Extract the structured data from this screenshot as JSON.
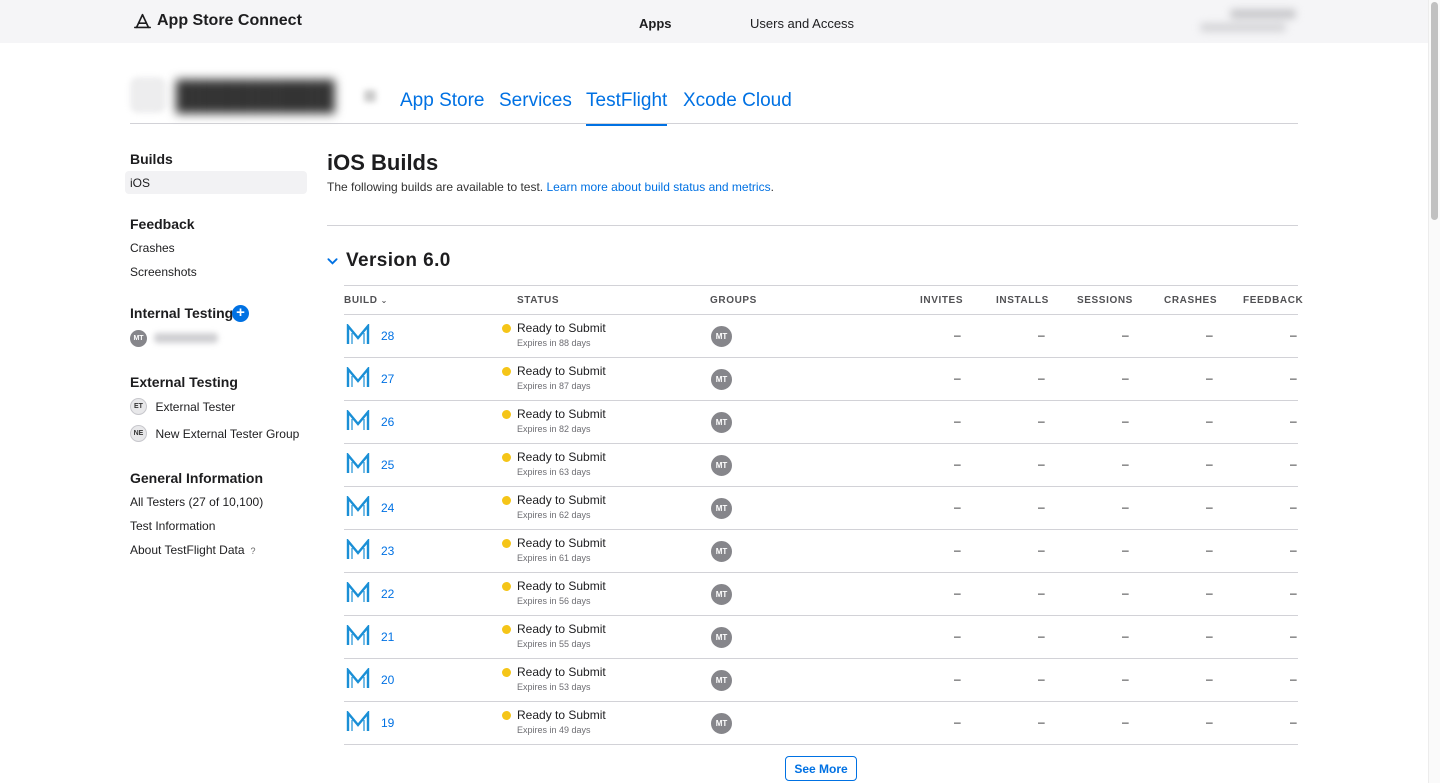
{
  "topbar": {
    "brand": "App Store Connect",
    "nav": [
      {
        "label": "Apps"
      },
      {
        "label": "Users and Access"
      }
    ]
  },
  "app_header": {
    "tabs": [
      {
        "label": "App Store",
        "active": false
      },
      {
        "label": "Services",
        "active": false
      },
      {
        "label": "TestFlight",
        "active": true
      },
      {
        "label": "Xcode Cloud",
        "active": false
      }
    ]
  },
  "sidebar": {
    "builds": {
      "title": "Builds",
      "items": [
        {
          "label": "iOS",
          "selected": true
        }
      ]
    },
    "feedback": {
      "title": "Feedback",
      "items": [
        {
          "label": "Crashes"
        },
        {
          "label": "Screenshots"
        }
      ]
    },
    "internal": {
      "title": "Internal Testing",
      "add": "+",
      "groups": [
        {
          "initials": "MT"
        }
      ]
    },
    "external": {
      "title": "External Testing",
      "groups": [
        {
          "initials": "ET",
          "label": "External Tester"
        },
        {
          "initials": "NE",
          "label": "New External Tester Group"
        }
      ]
    },
    "general": {
      "title": "General Information",
      "items": [
        {
          "label": "All Testers (27 of 10,100)"
        },
        {
          "label": "Test Information"
        },
        {
          "label": "About TestFlight Data",
          "help": "?"
        }
      ]
    }
  },
  "main": {
    "title": "iOS Builds",
    "subtitle_text": "The following builds are available to test.",
    "subtitle_link": "Learn more about build status and metrics",
    "subtitle_end": ".",
    "version": "Version 6.0",
    "columns": [
      "BUILD",
      "STATUS",
      "GROUPS",
      "INVITES",
      "INSTALLS",
      "SESSIONS",
      "CRASHES",
      "FEEDBACK"
    ],
    "status_color": "#f5c518",
    "rows": [
      {
        "build": "28",
        "status": "Ready to Submit",
        "expires": "Expires in 88 days",
        "group": "MT",
        "invites": "–",
        "installs": "–",
        "sessions": "–",
        "crashes": "–",
        "feedback": "–"
      },
      {
        "build": "27",
        "status": "Ready to Submit",
        "expires": "Expires in 87 days",
        "group": "MT",
        "invites": "–",
        "installs": "–",
        "sessions": "–",
        "crashes": "–",
        "feedback": "–"
      },
      {
        "build": "26",
        "status": "Ready to Submit",
        "expires": "Expires in 82 days",
        "group": "MT",
        "invites": "–",
        "installs": "–",
        "sessions": "–",
        "crashes": "–",
        "feedback": "–"
      },
      {
        "build": "25",
        "status": "Ready to Submit",
        "expires": "Expires in 63 days",
        "group": "MT",
        "invites": "–",
        "installs": "–",
        "sessions": "–",
        "crashes": "–",
        "feedback": "–"
      },
      {
        "build": "24",
        "status": "Ready to Submit",
        "expires": "Expires in 62 days",
        "group": "MT",
        "invites": "–",
        "installs": "–",
        "sessions": "–",
        "crashes": "–",
        "feedback": "–"
      },
      {
        "build": "23",
        "status": "Ready to Submit",
        "expires": "Expires in 61 days",
        "group": "MT",
        "invites": "–",
        "installs": "–",
        "sessions": "–",
        "crashes": "–",
        "feedback": "–"
      },
      {
        "build": "22",
        "status": "Ready to Submit",
        "expires": "Expires in 56 days",
        "group": "MT",
        "invites": "–",
        "installs": "–",
        "sessions": "–",
        "crashes": "–",
        "feedback": "–"
      },
      {
        "build": "21",
        "status": "Ready to Submit",
        "expires": "Expires in 55 days",
        "group": "MT",
        "invites": "–",
        "installs": "–",
        "sessions": "–",
        "crashes": "–",
        "feedback": "–"
      },
      {
        "build": "20",
        "status": "Ready to Submit",
        "expires": "Expires in 53 days",
        "group": "MT",
        "invites": "–",
        "installs": "–",
        "sessions": "–",
        "crashes": "–",
        "feedback": "–"
      },
      {
        "build": "19",
        "status": "Ready to Submit",
        "expires": "Expires in 49 days",
        "group": "MT",
        "invites": "–",
        "installs": "–",
        "sessions": "–",
        "crashes": "–",
        "feedback": "–"
      }
    ],
    "see_more": "See More"
  }
}
